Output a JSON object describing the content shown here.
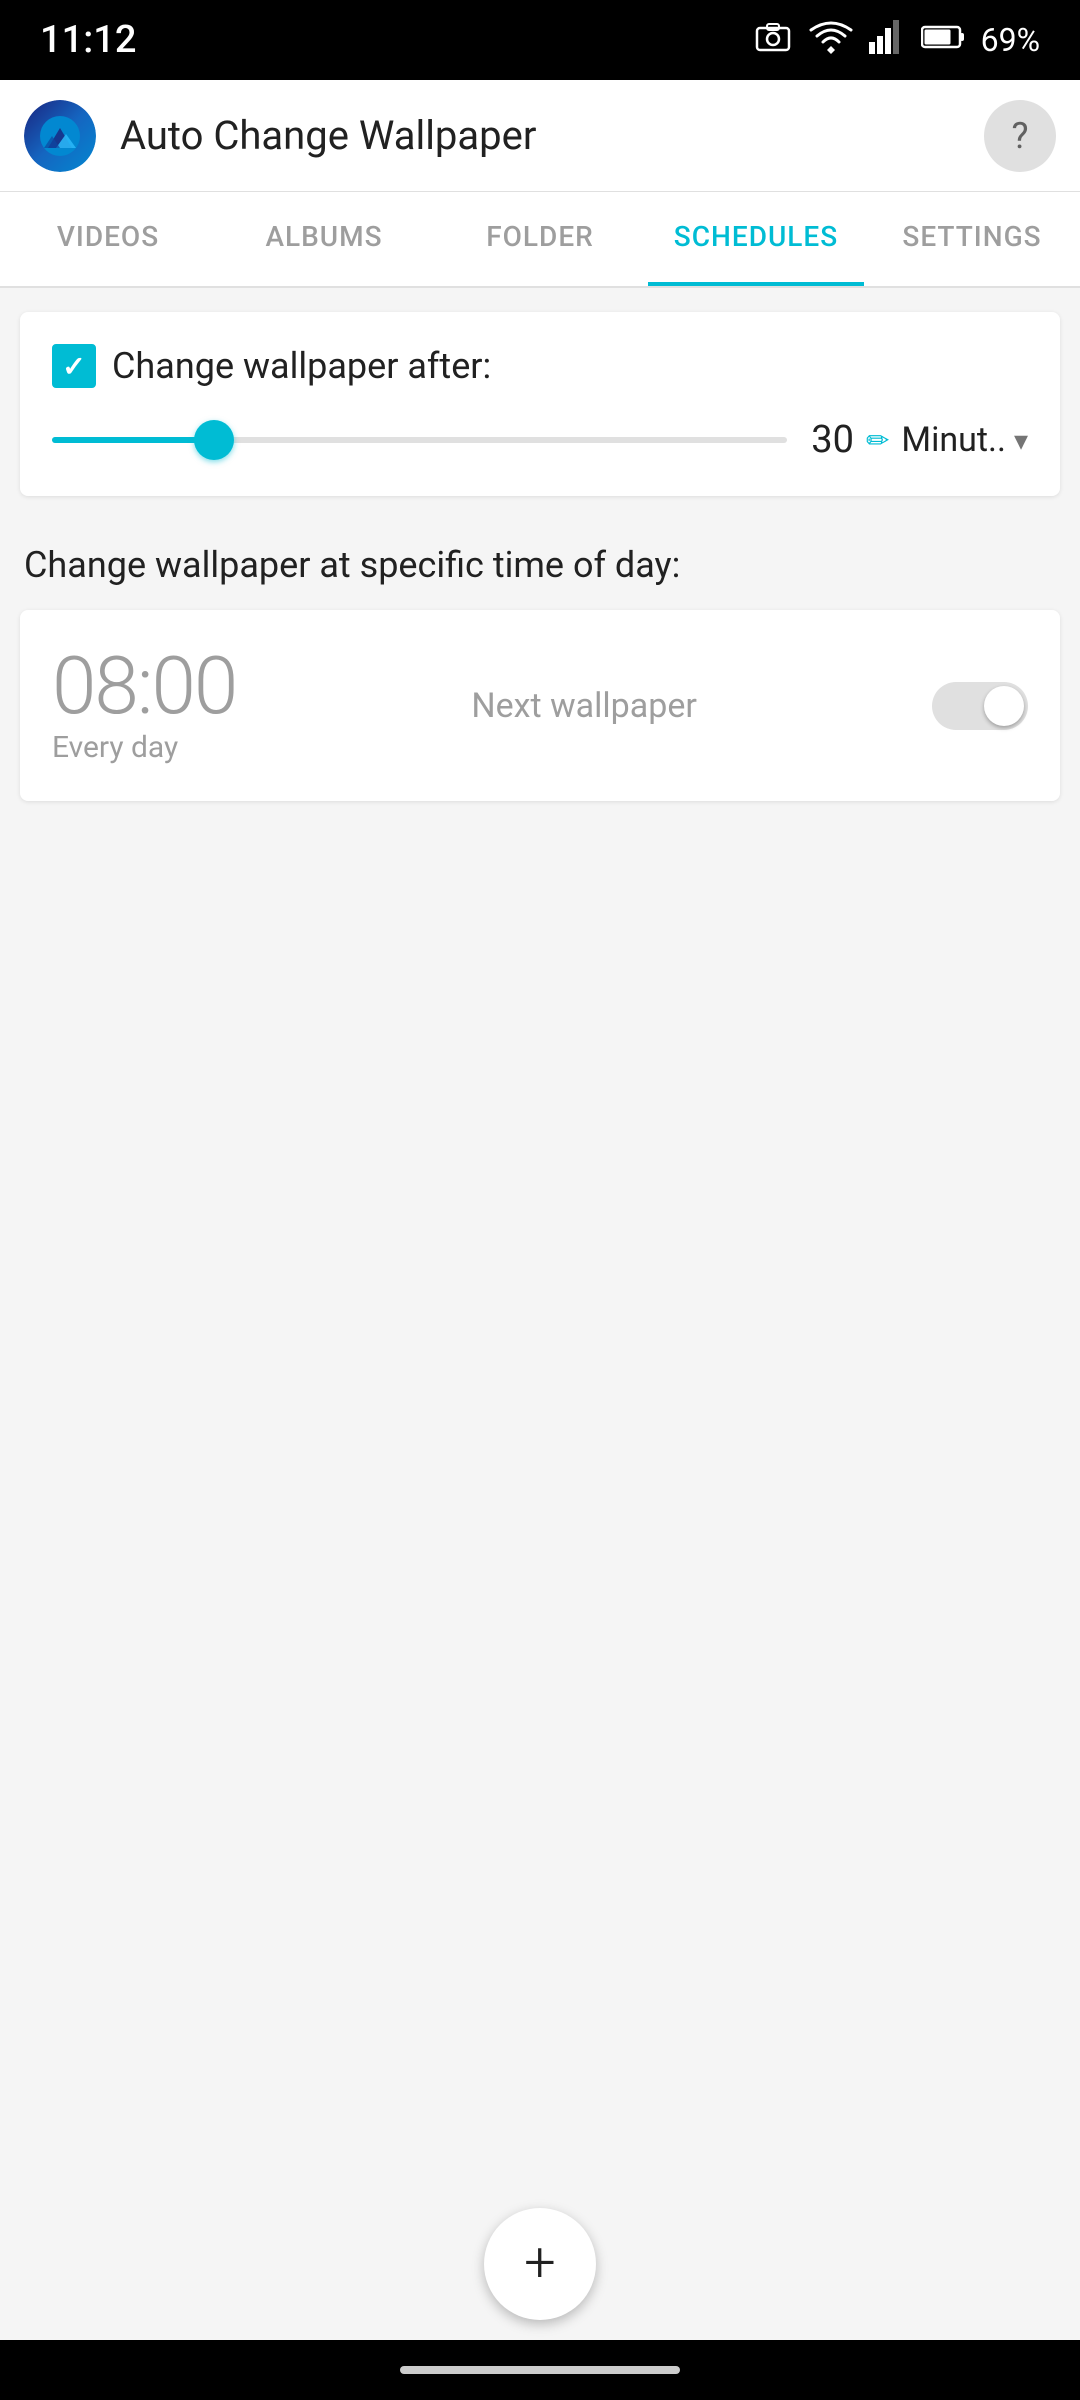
{
  "status_bar": {
    "time": "11:12",
    "battery_pct": "69%"
  },
  "app_bar": {
    "title": "Auto Change Wallpaper",
    "help_icon": "?"
  },
  "tabs": [
    {
      "id": "videos",
      "label": "VIDEOS",
      "active": false
    },
    {
      "id": "albums",
      "label": "ALBUMS",
      "active": false
    },
    {
      "id": "folder",
      "label": "FOLDER",
      "active": false
    },
    {
      "id": "schedules",
      "label": "SCHEDULES",
      "active": true
    },
    {
      "id": "settings",
      "label": "SETTINGS",
      "active": false
    }
  ],
  "change_after": {
    "checkbox_checked": true,
    "label": "Change wallpaper after:",
    "slider_value": 30,
    "slider_percent": 22,
    "unit": "Minut..",
    "edit_icon": "✏"
  },
  "specific_time": {
    "section_label": "Change wallpaper at specific time of day:",
    "schedules": [
      {
        "time": "08:00",
        "days": "Every day",
        "action": "Next wallpaper",
        "enabled": false
      }
    ]
  },
  "fab": {
    "icon": "+"
  }
}
